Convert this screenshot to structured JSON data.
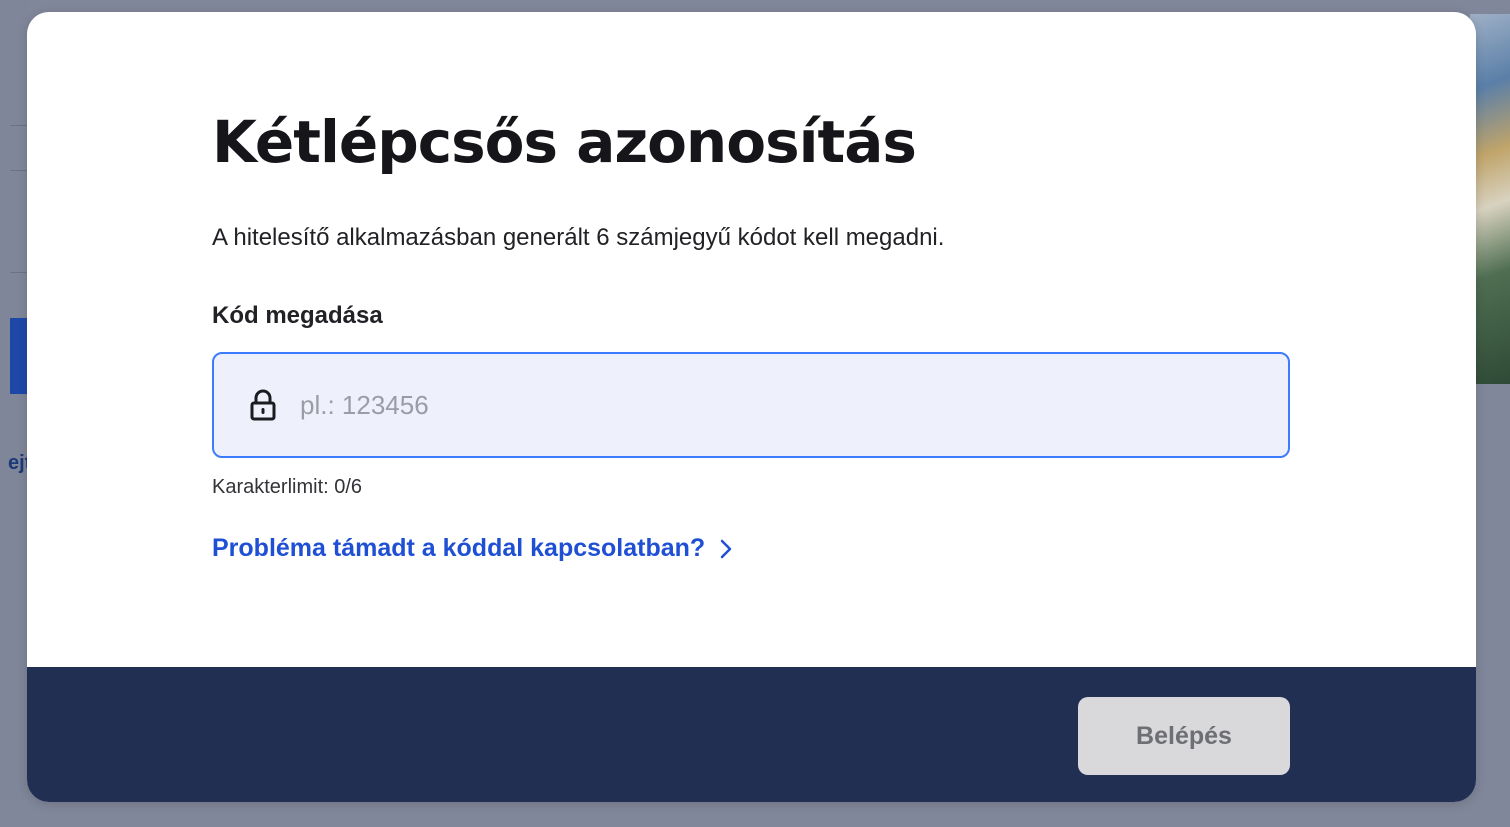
{
  "background": {
    "partial_text": "ejt"
  },
  "modal": {
    "title": "Kétlépcsős azonosítás",
    "description": "A hitelesítő alkalmazásban generált 6 számjegyű kódot kell megadni.",
    "field_label": "Kód megadása",
    "code_input": {
      "value": "",
      "placeholder": "pl.: 123456",
      "icon": "lock-icon"
    },
    "char_limit": "Karakterlimit: 0/6",
    "help_link": {
      "label": "Probléma támadt a kóddal kapcsolatban?",
      "icon": "chevron-right-icon"
    },
    "footer": {
      "login_button": "Belépés",
      "login_enabled": false
    }
  },
  "colors": {
    "accent": "#3d7bff",
    "link": "#1f4fd4",
    "footer_bg": "#213052",
    "input_bg": "#eef0fb",
    "button_disabled_bg": "#d9d9db"
  }
}
